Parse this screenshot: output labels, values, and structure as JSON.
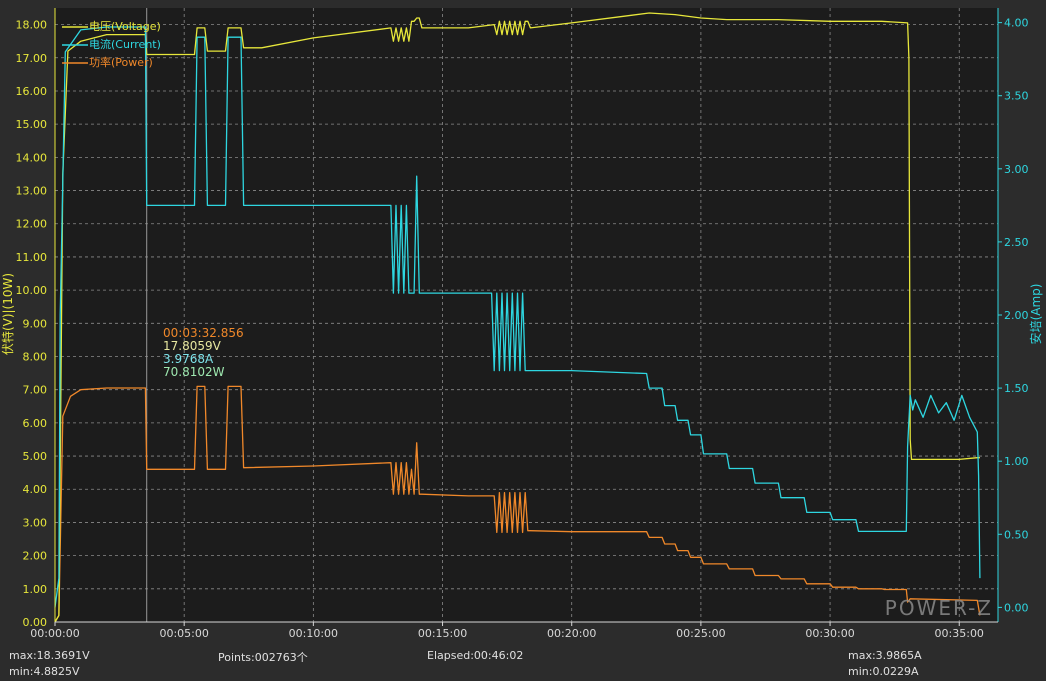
{
  "colors": {
    "background": "#2c2c2c",
    "plot_background": "#1c1c1c",
    "grid": "#8a8a8a",
    "voltage": "#e7e73b",
    "current": "#2ed6e0",
    "power": "#f0882a",
    "left_axis_text": "#e7e73b",
    "right_axis_text": "#2ed6e0",
    "x_axis_text": "#d8d8d8",
    "cursor_line": "#9a9a9a",
    "readout_time": "#f0882a",
    "readout_voltage": "#e7e7a0",
    "readout_current": "#7ee3ea",
    "readout_power": "#9ee8b0",
    "watermark": "#8a8a8a"
  },
  "watermark": "POWER-Z",
  "status": {
    "max_left": "max:18.3691V",
    "min_left": "min:4.8825V",
    "points": "Points:002763个",
    "elapsed": "Elapsed:00:46:02",
    "max_right": "max:3.9865A",
    "min_right": "min:0.0229A"
  },
  "cursor_readout": {
    "time": "00:03:32.856",
    "voltage": "17.8059V",
    "current": "3.9768A",
    "power": "70.8102W"
  },
  "chart_data": {
    "type": "line",
    "title": "",
    "xlabel": "",
    "ylabel": "伏特(V)|(10W)",
    "y2label": "安培(Amp)",
    "x_unit": "minutes",
    "xlim": [
      0,
      36.5
    ],
    "ylim": [
      0,
      18.5
    ],
    "y2lim": [
      -0.1,
      4.1
    ],
    "x_ticks": [
      "00:00:00",
      "00:05:00",
      "00:10:00",
      "00:15:00",
      "00:20:00",
      "00:25:00",
      "00:30:00",
      "00:35:00"
    ],
    "y_ticks": [
      "0.00",
      "1.00",
      "2.00",
      "3.00",
      "4.00",
      "5.00",
      "6.00",
      "7.00",
      "8.00",
      "9.00",
      "10.00",
      "11.00",
      "12.00",
      "13.00",
      "14.00",
      "15.00",
      "16.00",
      "17.00",
      "18.00"
    ],
    "y2_ticks": [
      "0.00",
      "0.50",
      "1.00",
      "1.50",
      "2.00",
      "2.50",
      "3.00",
      "3.50",
      "4.00"
    ],
    "grid": true,
    "legend_position": "top-left",
    "cursor_x": 3.55,
    "series": [
      {
        "name": "电压(Voltage)",
        "axis": "left",
        "x": [
          0,
          0.15,
          0.3,
          0.5,
          1.0,
          2.0,
          3.5,
          3.55,
          5.4,
          5.5,
          5.8,
          5.9,
          6.6,
          6.7,
          7.2,
          7.3,
          8,
          10,
          13,
          13.1,
          13.2,
          13.3,
          13.4,
          13.5,
          13.6,
          13.7,
          13.8,
          13.9,
          14.0,
          14.1,
          14.2,
          16,
          17.0,
          17.1,
          17.2,
          17.3,
          17.4,
          17.5,
          17.6,
          17.7,
          17.8,
          17.9,
          18.0,
          18.1,
          18.2,
          18.3,
          18.4,
          20,
          22,
          23,
          24,
          25,
          26,
          28,
          30,
          32,
          33.0,
          33.05,
          33.1,
          33.15,
          35,
          35.7,
          35.8
        ],
        "y": [
          0,
          0.2,
          13.5,
          17.2,
          17.5,
          17.7,
          17.7,
          17.1,
          17.1,
          17.9,
          17.9,
          17.2,
          17.2,
          17.9,
          17.9,
          17.3,
          17.3,
          17.6,
          17.9,
          17.5,
          17.9,
          17.5,
          17.9,
          17.5,
          17.9,
          17.5,
          18.1,
          18.1,
          18.2,
          18.2,
          17.9,
          17.9,
          18.0,
          17.7,
          18.1,
          17.7,
          18.1,
          17.7,
          18.1,
          17.7,
          18.1,
          17.7,
          18.1,
          17.7,
          18.1,
          18.1,
          17.9,
          18.05,
          18.25,
          18.35,
          18.3,
          18.2,
          18.15,
          18.15,
          18.1,
          18.1,
          18.05,
          17.0,
          5.5,
          4.9,
          4.9,
          4.95,
          4.95
        ]
      },
      {
        "name": "电流(Current)",
        "axis": "right",
        "x": [
          0,
          0.15,
          0.2,
          0.4,
          1.0,
          2.0,
          3.5,
          3.55,
          5.4,
          5.5,
          5.8,
          5.9,
          6.6,
          6.7,
          7.2,
          7.3,
          10,
          12.9,
          13.0,
          13.1,
          13.2,
          13.3,
          13.4,
          13.5,
          13.6,
          13.7,
          13.8,
          13.9,
          14.0,
          14.1,
          14.2,
          16,
          16.9,
          17.0,
          17.1,
          17.2,
          17.3,
          17.4,
          17.5,
          17.6,
          17.7,
          17.8,
          17.9,
          18.0,
          18.1,
          18.2,
          18.3,
          18.4,
          20,
          22.9,
          23.0,
          23.5,
          23.6,
          24.0,
          24.1,
          24.5,
          24.6,
          25.0,
          25.1,
          26.0,
          26.1,
          27.0,
          27.1,
          28.0,
          28.1,
          29.0,
          29.1,
          30.0,
          30.1,
          31.0,
          31.1,
          32.0,
          32.1,
          32.95,
          33.0,
          33.1,
          33.2,
          33.3,
          33.6,
          33.9,
          34.2,
          34.5,
          34.8,
          35.1,
          35.4,
          35.7,
          35.75,
          35.8
        ],
        "y": [
          0,
          0.2,
          2.0,
          3.8,
          3.95,
          3.97,
          3.97,
          2.75,
          2.75,
          3.9,
          3.9,
          2.75,
          2.75,
          3.9,
          3.9,
          2.75,
          2.75,
          2.75,
          2.75,
          2.15,
          2.75,
          2.15,
          2.75,
          2.15,
          2.75,
          2.15,
          2.15,
          2.15,
          2.95,
          2.15,
          2.15,
          2.15,
          2.15,
          1.62,
          2.15,
          1.62,
          2.15,
          1.62,
          2.15,
          1.62,
          2.15,
          1.62,
          2.15,
          1.62,
          2.15,
          1.62,
          1.62,
          1.62,
          1.62,
          1.6,
          1.5,
          1.5,
          1.38,
          1.38,
          1.28,
          1.28,
          1.18,
          1.18,
          1.05,
          1.05,
          0.95,
          0.95,
          0.85,
          0.85,
          0.75,
          0.75,
          0.65,
          0.65,
          0.6,
          0.6,
          0.52,
          0.52,
          0.52,
          0.52,
          1.1,
          1.45,
          1.35,
          1.42,
          1.3,
          1.45,
          1.33,
          1.4,
          1.28,
          1.45,
          1.3,
          1.2,
          0.9,
          0.2
        ]
      },
      {
        "name": "功率(Power)",
        "axis": "left",
        "x": [
          0,
          0.15,
          0.3,
          0.6,
          1.0,
          2.0,
          3.5,
          3.55,
          5.4,
          5.5,
          5.8,
          5.9,
          6.6,
          6.7,
          7.2,
          7.3,
          10,
          13.0,
          13.1,
          13.2,
          13.3,
          13.4,
          13.5,
          13.6,
          13.7,
          13.8,
          13.9,
          14.0,
          14.1,
          14.2,
          16,
          17.0,
          17.1,
          17.2,
          17.3,
          17.4,
          17.5,
          17.6,
          17.7,
          17.8,
          17.9,
          18.0,
          18.1,
          18.2,
          18.3,
          18.4,
          20,
          22.9,
          23.0,
          23.5,
          23.6,
          24.0,
          24.1,
          24.5,
          24.6,
          25.0,
          25.1,
          26.0,
          26.1,
          27.0,
          27.1,
          28.0,
          28.1,
          29.0,
          29.1,
          30.0,
          30.1,
          31.0,
          31.1,
          32.0,
          32.1,
          32.95,
          33.0,
          33.1,
          35.7,
          35.8
        ],
        "y": [
          0,
          0.2,
          6.2,
          6.8,
          7.0,
          7.05,
          7.05,
          4.6,
          4.6,
          7.1,
          7.1,
          4.6,
          4.6,
          7.1,
          7.1,
          4.65,
          4.7,
          4.8,
          3.85,
          4.8,
          3.85,
          4.8,
          3.85,
          4.8,
          3.85,
          4.6,
          3.85,
          5.4,
          3.85,
          3.85,
          3.8,
          3.8,
          2.7,
          3.9,
          2.7,
          3.9,
          2.7,
          3.9,
          2.7,
          3.9,
          2.7,
          3.9,
          2.7,
          3.9,
          2.75,
          2.75,
          2.72,
          2.72,
          2.55,
          2.55,
          2.35,
          2.35,
          2.15,
          2.15,
          1.95,
          1.95,
          1.75,
          1.75,
          1.6,
          1.6,
          1.4,
          1.4,
          1.3,
          1.3,
          1.15,
          1.15,
          1.05,
          1.05,
          1.0,
          1.0,
          0.98,
          0.98,
          0.6,
          0.7,
          0.65,
          0.2
        ]
      }
    ]
  }
}
